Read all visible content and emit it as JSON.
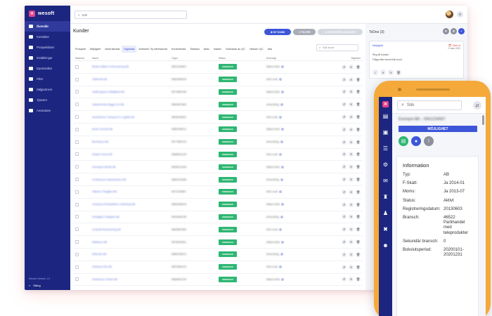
{
  "app": {
    "brand": "wesoft",
    "version_text": "Wesoft Version 1.0"
  },
  "sidebar": {
    "items": [
      {
        "label": "Översikt",
        "icon": "dashboard-icon",
        "active": true
      },
      {
        "label": "Kontakter",
        "icon": "contacts-icon"
      },
      {
        "label": "Prospektlister",
        "icon": "list-icon"
      },
      {
        "label": "Inställningar",
        "icon": "gear-icon"
      },
      {
        "label": "Epostmallar",
        "icon": "mail-icon"
      },
      {
        "label": "Filter",
        "icon": "filter-icon"
      },
      {
        "label": "Säljpartners",
        "icon": "partners-icon"
      },
      {
        "label": "Tjänster",
        "icon": "tools-icon"
      },
      {
        "label": "Användare",
        "icon": "users-icon"
      }
    ],
    "close_label": "Stäng"
  },
  "topbar": {
    "search_placeholder": "Sök"
  },
  "main": {
    "title": "Kunder",
    "buttons": {
      "new": "NY KUND",
      "filter": "FILTER",
      "export": "EXPORTERA KUNDER"
    },
    "tabs": [
      "Prospekt",
      "Möjlighet",
      "Avtal skickat",
      "Signerad",
      "Avbrutet / Ej intresserad",
      "Kontrollerad",
      "Skickad",
      "Aktiv",
      "Inaktiv",
      "Granskas av QC",
      "Nekad i QC",
      "Alla"
    ],
    "active_tab": "Signerad",
    "filter_placeholder": "Sök kund",
    "columns": [
      "Markera",
      "Namn",
      "Orgnr",
      "Status",
      "Ansvarig",
      "Åtgärder"
    ],
    "rows": [
      {
        "name": "Bodas Måleri & Renovering AB",
        "org": "5591234567",
        "status": "SIGNERAD",
        "owner": "Maria Holm"
      },
      {
        "name": "Tälteknik AB",
        "org": "5562345678",
        "status": "SIGNERAD",
        "owner": "Erik Lund"
      },
      {
        "name": "Hallbergsons Städtjänst AB",
        "org": "5573456789",
        "status": "SIGNERAD",
        "owner": "Maria Holm"
      },
      {
        "name": "Västsvenska Bygg & El AB",
        "org": "5584567890",
        "status": "SIGNERAD",
        "owner": "Anna Berg"
      },
      {
        "name": "Nordströms Transport & Logistik AB",
        "org": "5595678901",
        "status": "SIGNERAD",
        "owner": "Erik Lund"
      },
      {
        "name": "Bodin Konsult AB",
        "org": "5566789012",
        "status": "SIGNERAD",
        "owner": "Maria Holm"
      },
      {
        "name": "Berntsson AB",
        "org": "5577890123",
        "status": "SIGNERAD",
        "owner": "Anna Berg"
      },
      {
        "name": "Ekdahl Invest AB",
        "org": "5588901234",
        "status": "SIGNERAD",
        "owner": "Erik Lund"
      },
      {
        "name": "Granqvist Media AB",
        "org": "5599012345",
        "status": "SIGNERAD",
        "owner": "Maria Holm"
      },
      {
        "name": "Fredriksson Markarbeten AB",
        "org": "5560123456",
        "status": "SIGNERAD",
        "owner": "Anna Berg"
      },
      {
        "name": "Håkans Trädgård AB",
        "org": "5571234567",
        "status": "SIGNERAD",
        "owner": "Erik Lund"
      },
      {
        "name": "Jonssons Elinstallation Göteborg AB",
        "org": "5582345678",
        "status": "SIGNERAD",
        "owner": "Maria Holm"
      },
      {
        "name": "Karlsgård Fastighet AB",
        "org": "5593456789",
        "status": "SIGNERAD",
        "owner": "Anna Berg"
      },
      {
        "name": "Lindvall Redovisning AB",
        "org": "5564567890",
        "status": "SIGNERAD",
        "owner": "Erik Lund"
      },
      {
        "name": "Mattsson AB",
        "org": "5575678901",
        "status": "SIGNERAD",
        "owner": "Maria Holm"
      },
      {
        "name": "Nilsholm AB",
        "org": "5586789012",
        "status": "SIGNERAD",
        "owner": "Anna Berg"
      },
      {
        "name": "Olofsson Rör AB",
        "org": "5597890123",
        "status": "SIGNERAD",
        "owner": "Erik Lund"
      },
      {
        "name": "Pettersson Smide AB",
        "org": "5568901234",
        "status": "SIGNERAD",
        "owner": "Maria Holm"
      }
    ]
  },
  "todos": {
    "title": "ToDos (3)",
    "card": {
      "type": "Möjlighet",
      "due_label": "Gick ut",
      "due_date": "2 mars 2022",
      "line1": "Ring till kunden",
      "line2": "Fråga efter beslut från kund"
    }
  },
  "phone": {
    "search_placeholder": "Sök",
    "company_name": "Exempel AB – 5561234567",
    "status_badge": "MÖJLIGHET",
    "info_title": "Information",
    "info": [
      {
        "k": "Typ:",
        "v": "AB"
      },
      {
        "k": "F-Skatt:",
        "v": "Ja 2014-01"
      },
      {
        "k": "Moms:",
        "v": "Ja 2013-07"
      },
      {
        "k": "Status:",
        "v": "Aktivt"
      },
      {
        "k": "Registreringsdatum:",
        "v": "20130603"
      },
      {
        "k": "Bransch:",
        "v": "46522 Partihandel med teleprodukter"
      },
      {
        "k": "Sekundär bransch:",
        "v": "0"
      },
      {
        "k": "Bokslutsperiod:",
        "v": "20200101-20201231"
      }
    ]
  },
  "colors": {
    "sidebar": "#1c2680",
    "accent": "#3d56d8",
    "brand_pink": "#e8408a",
    "status_green": "#2eb673",
    "phone_body": "#f4a93a"
  }
}
